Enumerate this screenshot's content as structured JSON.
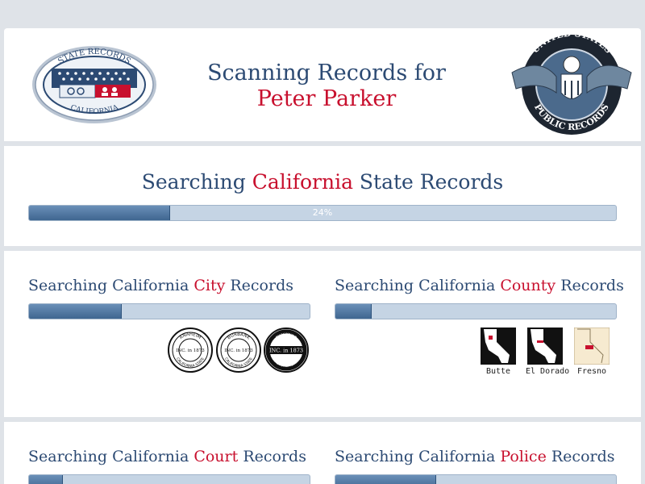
{
  "header": {
    "title_line1": "Scanning Records for",
    "title_name": "Peter Parker",
    "logo_left": {
      "text_top": "STATE RECORDS",
      "text_bottom": "CALIFORNIA"
    },
    "logo_right": {
      "text_top": "UNITED STATES",
      "text_bottom": "PUBLIC RECORDS"
    }
  },
  "state_search": {
    "prefix": "Searching",
    "state": "California",
    "suffix": "State Records",
    "progress": 0.24,
    "progress_label": "24%"
  },
  "city_search": {
    "prefix": "Searching California",
    "highlight": "City",
    "suffix": "Records",
    "progress": 0.33,
    "seals": [
      {
        "top": "ANAHEIM",
        "middle": "INC. in 1873",
        "bottom": "CALIFORNIA STATE"
      },
      {
        "top": "BURBANK",
        "middle": "INC. in 1873",
        "bottom": "CALIFORNIA STATE"
      },
      {
        "top": "CUPERTINO",
        "middle": "INC. in 1873",
        "bottom": "CALIFORNIA STATE"
      }
    ]
  },
  "county_search": {
    "prefix": "Searching California",
    "highlight": "County",
    "suffix": "Records",
    "progress": 0.13,
    "counties": [
      {
        "name": "Butte"
      },
      {
        "name": "El Dorado"
      },
      {
        "name": "Fresno"
      }
    ]
  },
  "court_search": {
    "prefix": "Searching California",
    "highlight": "Court",
    "suffix": "Records",
    "progress": 0.12
  },
  "police_search": {
    "prefix": "Searching California",
    "highlight": "Police",
    "suffix": "Records",
    "progress": 0.36
  },
  "colors": {
    "navy": "#2c4a73",
    "red": "#c8102e",
    "bar_fill": "#4a719c",
    "bar_track": "#c5d4e4",
    "page_bg": "#dfe3e8"
  }
}
